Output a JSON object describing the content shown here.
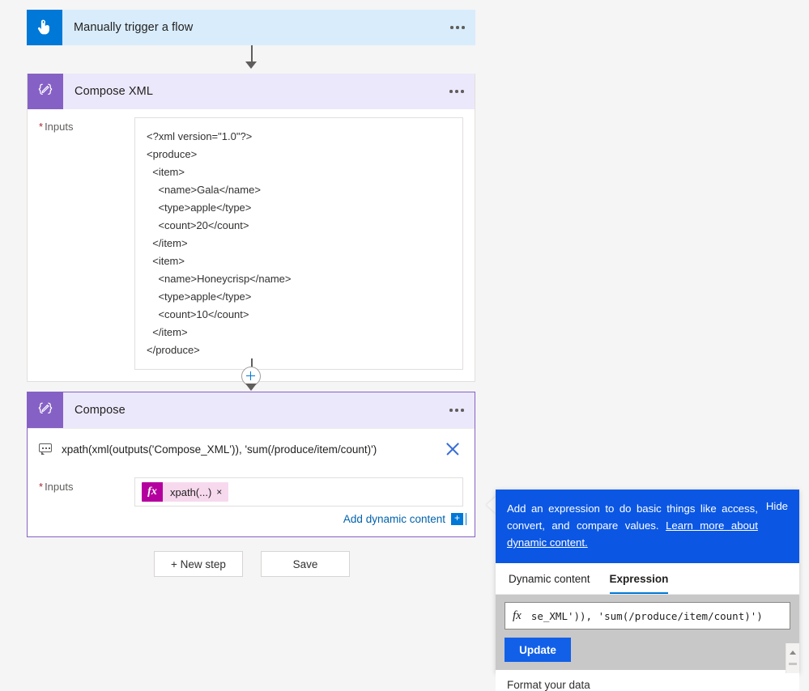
{
  "trigger": {
    "icon": "tap-hand-icon",
    "title": "Manually trigger a flow",
    "menu_label": "..."
  },
  "compose_xml": {
    "icon": "compose-braces-pencil-icon",
    "title": "Compose XML",
    "inputs_label": "Inputs",
    "required_marker": "*",
    "xml_lines": [
      "<?xml version=\"1.0\"?>",
      "<produce>",
      "  <item>",
      "    <name>Gala</name>",
      "    <type>apple</type>",
      "    <count>20</count>",
      "  </item>",
      "  <item>",
      "    <name>Honeycrisp</name>",
      "    <type>apple</type>",
      "    <count>10</count>",
      "  </item>",
      "</produce>"
    ]
  },
  "compose": {
    "icon": "compose-braces-pencil-icon",
    "title": "Compose",
    "expression_tooltip": "xpath(xml(outputs('Compose_XML')), 'sum(/produce/item/count)')",
    "close_label": "x",
    "inputs_label": "Inputs",
    "required_marker": "*",
    "token": {
      "fx_label": "fx",
      "label": "xpath(...)",
      "remove_label": "×"
    },
    "add_dynamic_content": "Add dynamic content",
    "add_dynamic_plus": "+"
  },
  "bottom_bar": {
    "new_step": "+ New step",
    "save": "Save"
  },
  "expression_panel": {
    "banner_text_part1": "Add an expression to do basic things like access, convert, and compare values. ",
    "banner_link": "Learn more about dynamic content.",
    "hide_label": "Hide",
    "tabs": [
      {
        "label": "Dynamic content",
        "active": false
      },
      {
        "label": "Expression",
        "active": true
      }
    ],
    "fx_glyph": "fx",
    "expression_value": "se_XML')), 'sum(/produce/item/count)')",
    "update_label": "Update",
    "footer_label": "Format your data"
  },
  "colors": {
    "trigger_accent": "#0078d7",
    "compose_accent": "#8661c5",
    "trigger_header_bg": "#d9ecfb",
    "compose_header_bg": "#ece8fb",
    "banner_blue": "#0b57e3",
    "token_pink": "#b4009e",
    "link_blue": "#0062ad",
    "required_red": "#a4262c",
    "page_bg": "#f5f5f5"
  }
}
